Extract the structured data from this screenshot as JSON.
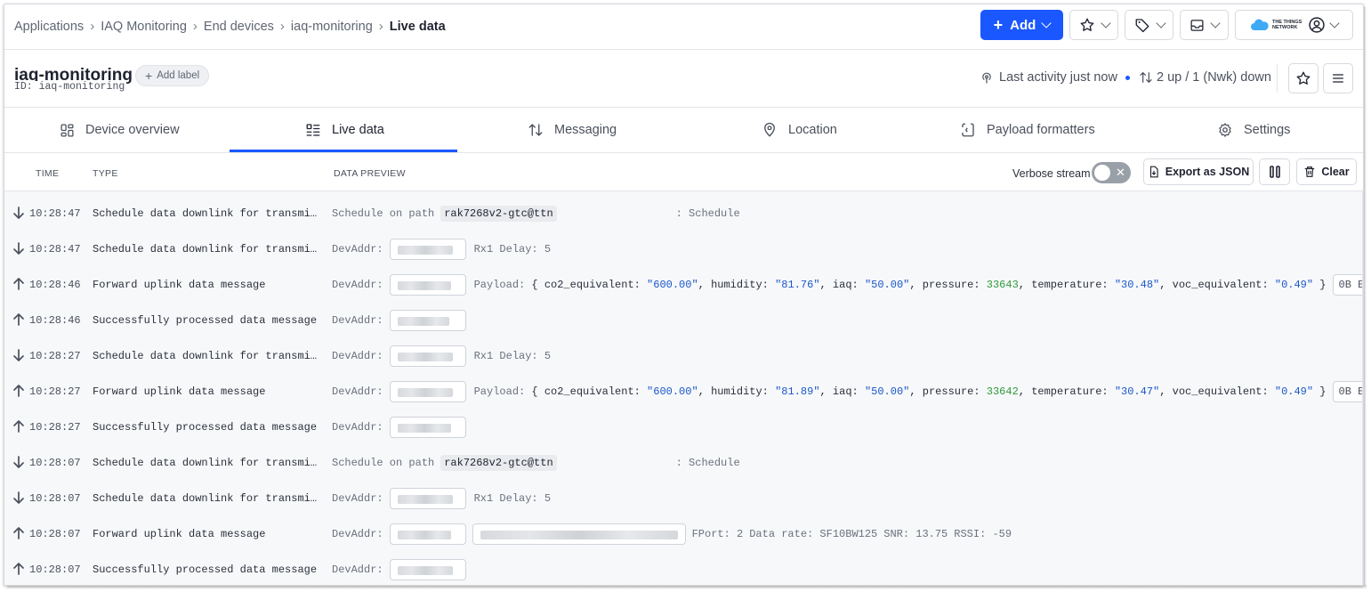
{
  "breadcrumbs": [
    "Applications",
    "IAQ Monitoring",
    "End devices",
    "iaq-monitoring",
    "Live data"
  ],
  "topbar": {
    "add_label": "Add",
    "brand": "THE THINGS NETWORK"
  },
  "device": {
    "name": "iaq-monitoring",
    "id_label": "ID:",
    "id_value": "iaq-monitoring",
    "add_label": "Add label",
    "activity": "Last activity just now",
    "traffic": "2 up / 1 (Nwk) down"
  },
  "tabs": [
    "Device overview",
    "Live data",
    "Messaging",
    "Location",
    "Payload formatters",
    "Settings"
  ],
  "table": {
    "headers": {
      "time": "TIME",
      "type": "TYPE",
      "preview": "DATA PREVIEW"
    },
    "verbose_label": "Verbose stream",
    "export_label": "Export as JSON",
    "clear_label": "Clear"
  },
  "rows": [
    {
      "dir": "down",
      "time": "10:28:47",
      "type": "Schedule data downlink for transmission",
      "kind": "schedule",
      "path": "rak7268v2-gtc@ttn",
      "suffix": ": Schedule"
    },
    {
      "dir": "down",
      "time": "10:28:47",
      "type": "Schedule data downlink for transmission",
      "kind": "rx1",
      "devaddr_label": "DevAddr:",
      "rx1": "Rx1 Delay: 5"
    },
    {
      "dir": "up",
      "time": "10:28:46",
      "type": "Forward uplink data message",
      "kind": "payload",
      "devaddr_label": "DevAddr:",
      "payload": {
        "co2_equivalent": "600.00",
        "humidity": "81.76",
        "iaq": "50.00",
        "pressure": "33643",
        "temperature": "30.48",
        "voc_equivalent": "0.49"
      },
      "size": "0B E"
    },
    {
      "dir": "up",
      "time": "10:28:46",
      "type": "Successfully processed data message",
      "kind": "devaddr",
      "devaddr_label": "DevAddr:"
    },
    {
      "dir": "down",
      "time": "10:28:27",
      "type": "Schedule data downlink for transmission",
      "kind": "rx1",
      "devaddr_label": "DevAddr:",
      "rx1": "Rx1 Delay: 5"
    },
    {
      "dir": "up",
      "time": "10:28:27",
      "type": "Forward uplink data message",
      "kind": "payload",
      "devaddr_label": "DevAddr:",
      "payload": {
        "co2_equivalent": "600.00",
        "humidity": "81.89",
        "iaq": "50.00",
        "pressure": "33642",
        "temperature": "30.47",
        "voc_equivalent": "0.49"
      },
      "size": "0B E"
    },
    {
      "dir": "up",
      "time": "10:28:27",
      "type": "Successfully processed data message",
      "kind": "devaddr",
      "devaddr_label": "DevAddr:"
    },
    {
      "dir": "down",
      "time": "10:28:07",
      "type": "Schedule data downlink for transmission",
      "kind": "schedule",
      "path": "rak7268v2-gtc@ttn",
      "suffix": ": Schedule"
    },
    {
      "dir": "down",
      "time": "10:28:07",
      "type": "Schedule data downlink for transmission",
      "kind": "rx1",
      "devaddr_label": "DevAddr:",
      "rx1": "Rx1 Delay: 5"
    },
    {
      "dir": "up",
      "time": "10:28:07",
      "type": "Forward uplink data message",
      "kind": "fport",
      "devaddr_label": "DevAddr:",
      "fport": "FPort: 2",
      "datarate": "Data rate: SF10BW125",
      "snr": "SNR: 13.75",
      "rssi": "RSSI: -59"
    },
    {
      "dir": "up",
      "time": "10:28:07",
      "type": "Successfully processed data message",
      "kind": "devaddr",
      "devaddr_label": "DevAddr:"
    }
  ],
  "colors": {
    "accent": "#1a57ff",
    "string": "#1a57c9",
    "number": "#2f9a3a"
  }
}
